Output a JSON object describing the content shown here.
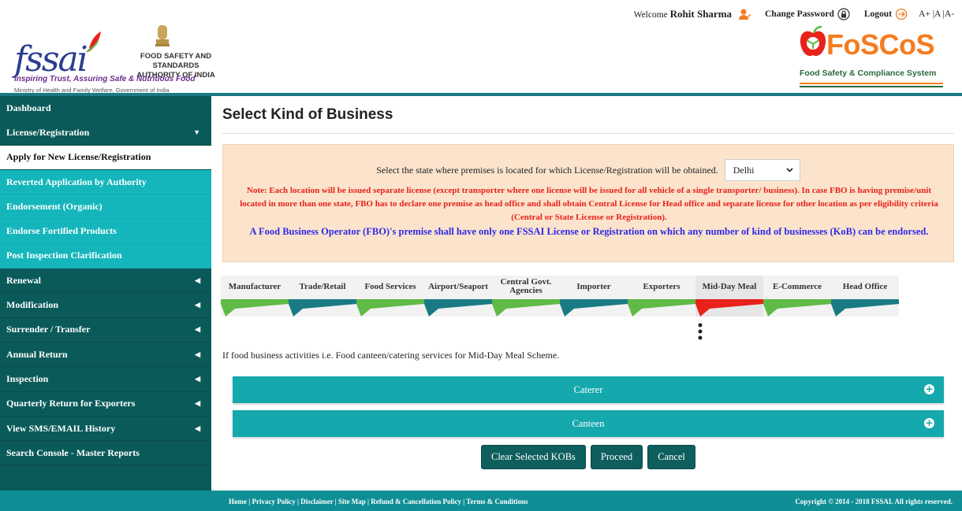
{
  "topbar": {
    "welcome_prefix": "Welcome",
    "user_name": "Rohit Sharma",
    "change_password": "Change Password",
    "logout": "Logout",
    "font_size": "A+ |A |A-"
  },
  "brand": {
    "fssai_word": "fssai",
    "authority_line1": "FOOD SAFETY AND STANDARDS",
    "authority_line2": "AUTHORITY OF INDIA",
    "tagline": "Inspiring Trust, Assuring Safe & Nutritious Food",
    "ministry": "Ministry of Health and Family Welfare, Government of India",
    "foscos_word": "FoSCoS",
    "foscos_sub": "Food Safety & Compliance System"
  },
  "sidebar": {
    "items": [
      {
        "label": "Dashboard"
      },
      {
        "label": "License/Registration"
      },
      {
        "label": "Apply for New License/Registration"
      },
      {
        "label": "Reverted Application by Authority"
      },
      {
        "label": "Endorsement (Organic)"
      },
      {
        "label": "Endorse Fortified Products"
      },
      {
        "label": "Post Inspection Clarification"
      },
      {
        "label": "Renewal"
      },
      {
        "label": "Modification"
      },
      {
        "label": "Surrender / Transfer"
      },
      {
        "label": "Annual Return"
      },
      {
        "label": "Inspection"
      },
      {
        "label": "Quarterly Return for Exporters"
      },
      {
        "label": "View SMS/EMAIL History"
      },
      {
        "label": "Search Console - Master Reports"
      }
    ]
  },
  "main": {
    "title": "Select Kind of Business",
    "state_prompt": "Select the state where premises is located for which License/Registration will be obtained.",
    "state_value": "Delhi",
    "note_red": "Note: Each location will be issued separate license (except transporter where one license will be issued for all vehicle of a single transporter/ business). In case FBO is having premise/unit located in more than one state, FBO has to declare one premise as head office and shall obtain Central License for Head office and separate license for other location as per eligibility criteria (Central or State License or Registration).",
    "note_blue": "A Food Business Operator (FBO)'s premise shall have only one FSSAI License or Registration on which any number of kind of businesses (KoB) can be endorsed.",
    "tabs": [
      {
        "label": "Manufacturer"
      },
      {
        "label": "Trade/Retail"
      },
      {
        "label": "Food Services"
      },
      {
        "label": "Airport/Seaport"
      },
      {
        "label": "Central Govt. Agencies"
      },
      {
        "label": "Importer"
      },
      {
        "label": "Exporters"
      },
      {
        "label": "Mid-Day Meal"
      },
      {
        "label": "E-Commerce"
      },
      {
        "label": "Head Office"
      }
    ],
    "selected_tab": "Mid-Day Meal",
    "kob_description": "If food business activities i.e. Food canteen/catering services for Mid-Day Meal Scheme.",
    "accordions": [
      {
        "label": "Caterer"
      },
      {
        "label": "Canteen"
      }
    ],
    "buttons": {
      "clear": "Clear Selected KOBs",
      "proceed": "Proceed",
      "cancel": "Cancel"
    }
  },
  "footer": {
    "links": "Home | Privacy Policy | Disclaimer | Site Map | Refund & Cancellation Policy | Terms & Conditions",
    "copyright": "Copyright © 2014 - 2018 FSSAI. All rights reserved."
  },
  "colors": {
    "sidebar_dark": "#0a5a5a",
    "sidebar_sub": "#14b6bc",
    "accordion": "#15a8ac",
    "tab_green": "#5fba46",
    "tab_teal": "#1a7a84",
    "tab_selected": "#e8211b",
    "notice_bg": "#fce4cc"
  }
}
